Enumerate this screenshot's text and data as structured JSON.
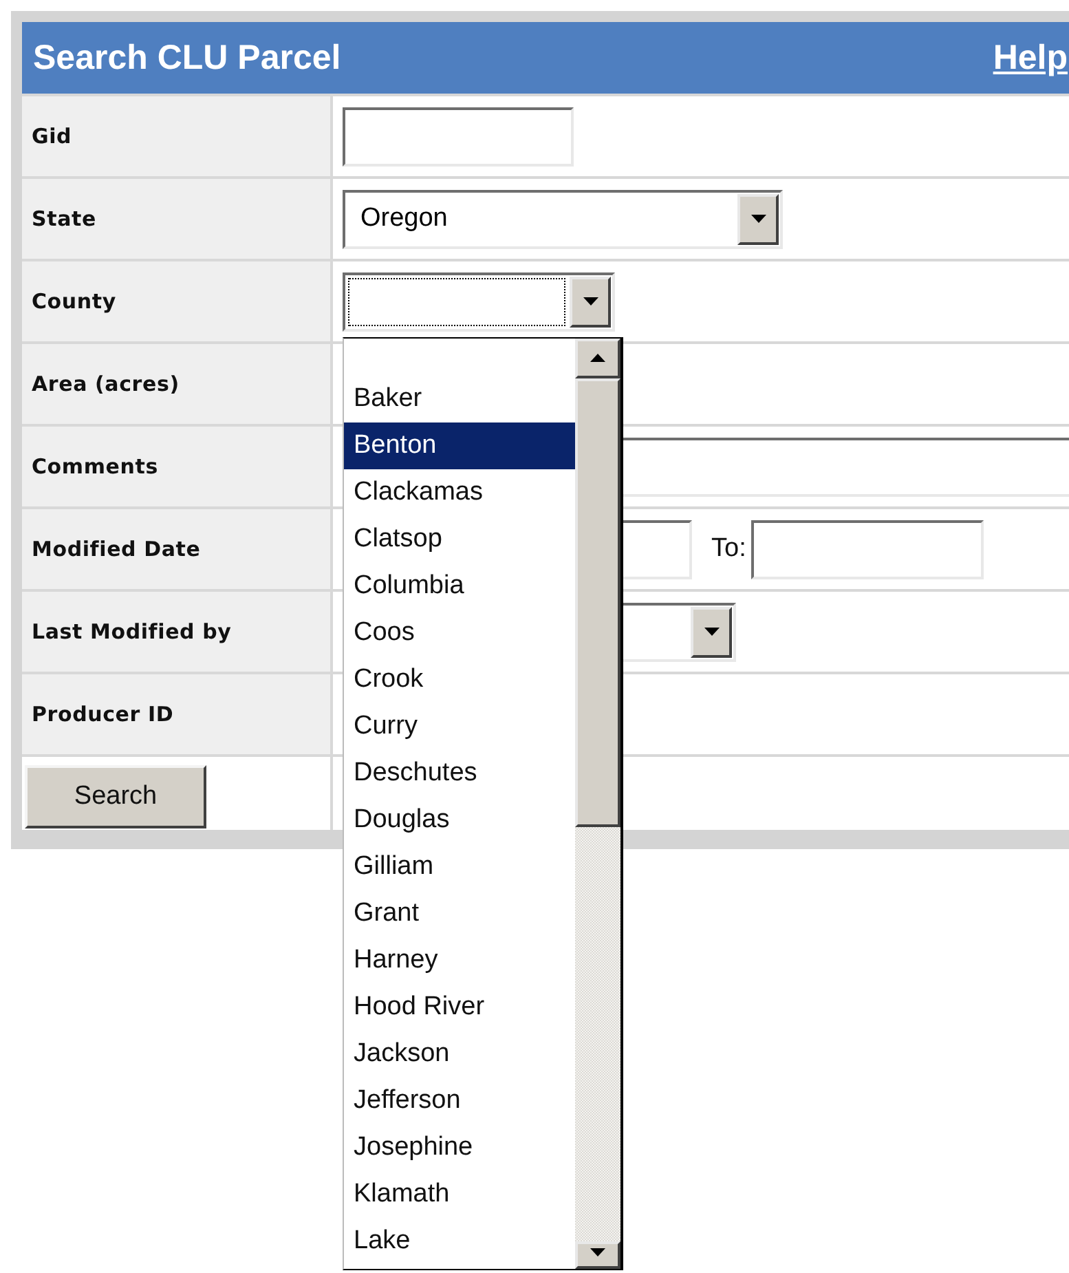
{
  "header": {
    "title": "Search CLU Parcel",
    "help_link": "Help"
  },
  "fields": [
    {
      "kind": "text",
      "label": "Gid"
    },
    {
      "kind": "select",
      "label": "State",
      "value": "Oregon"
    },
    {
      "kind": "select",
      "label": "County",
      "expanded": true,
      "options": [
        {
          "label": "Baker",
          "selected": false
        },
        {
          "label": "Benton",
          "selected": true
        },
        {
          "label": "Clackamas",
          "selected": false
        },
        {
          "label": "Clatsop",
          "selected": false
        },
        {
          "label": "Columbia",
          "selected": false
        },
        {
          "label": "Coos",
          "selected": false
        },
        {
          "label": "Crook",
          "selected": false
        },
        {
          "label": "Curry",
          "selected": false
        },
        {
          "label": "Deschutes",
          "selected": false
        },
        {
          "label": "Douglas",
          "selected": false
        },
        {
          "label": "Gilliam",
          "selected": false
        },
        {
          "label": "Grant",
          "selected": false
        },
        {
          "label": "Harney",
          "selected": false
        },
        {
          "label": "Hood River",
          "selected": false
        },
        {
          "label": "Jackson",
          "selected": false
        },
        {
          "label": "Jefferson",
          "selected": false
        },
        {
          "label": "Josephine",
          "selected": false
        },
        {
          "label": "Klamath",
          "selected": false
        },
        {
          "label": "Lake",
          "selected": false
        }
      ]
    },
    {
      "kind": "empty",
      "label": "Area (acres)"
    },
    {
      "kind": "wide_text",
      "label": "Comments"
    },
    {
      "kind": "date_range",
      "label": "Modified Date",
      "to_label": "To:"
    },
    {
      "kind": "select",
      "label": "Last Modified by"
    },
    {
      "kind": "empty",
      "label": "Producer ID"
    }
  ],
  "search_button": "Search"
}
